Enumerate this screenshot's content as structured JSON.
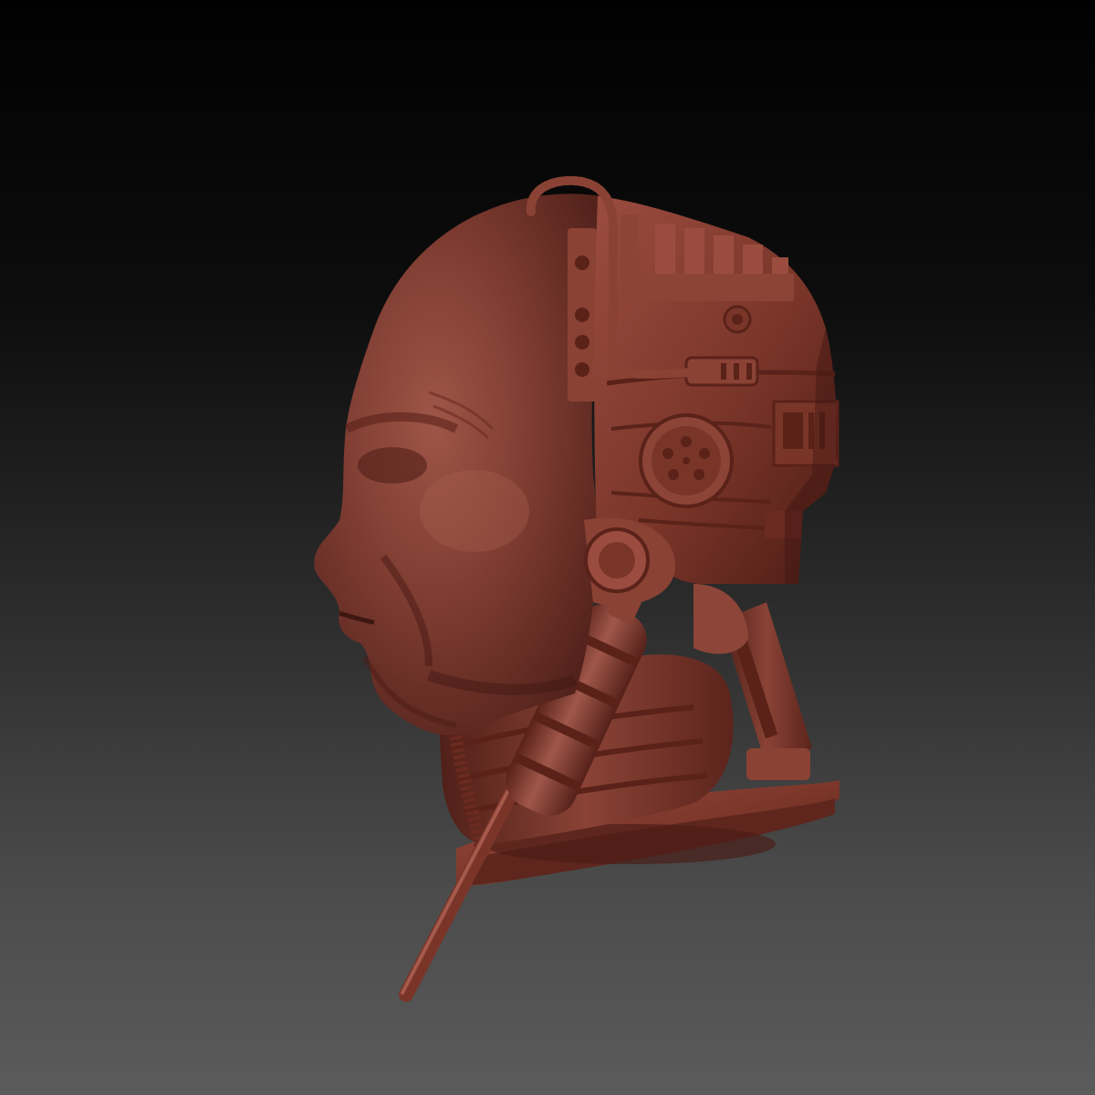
{
  "viewport": {
    "background_top": "#010101",
    "background_bottom": "#5b5b5b"
  },
  "sculpt": {
    "base_color": "#7a3a30",
    "shadow_color": "#4a1e18",
    "highlight_color": "#a0584a"
  }
}
